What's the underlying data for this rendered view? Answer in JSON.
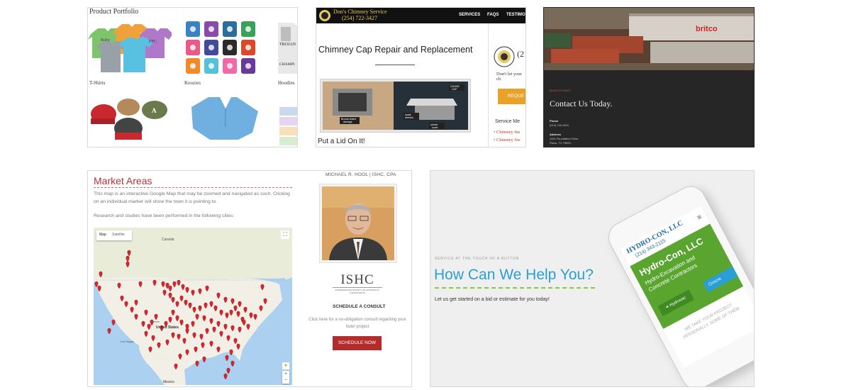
{
  "portfolio": {
    "title": "Product Portfolio",
    "captions": [
      "T-Shirts",
      "Koozies",
      "Hoodies"
    ]
  },
  "chimney": {
    "brand_name": "Don's Chimney Service",
    "brand_phone": "(254) 722-3427",
    "nav": [
      "SERVICES",
      "FAQS",
      "TESTIMO"
    ],
    "heading": "Chimney Cap Repair and Replacement",
    "subheading": "Put a Lid On It!",
    "side_phone": "(2",
    "side_tagline": "Don't let your ch",
    "side_button": "REQUE",
    "side_menu_title": "Service Me",
    "side_menu": [
      "Chimney Ins",
      "Chimney Sw"
    ],
    "photo_labels": [
      "Bronze-fluted damage",
      "spark arrestor",
      "GOOSE CAP",
      "screen cover"
    ]
  },
  "contact": {
    "roof_sign": "britco",
    "eyebrow": "QUESTIONS?",
    "heading": "Contact Us Today.",
    "phone_label": "Phone",
    "phone_value": "(214) 741-6311",
    "address_label": "Address",
    "address_line1": "1101 Foundation Drive",
    "address_line2": "Plano, TX 75093"
  },
  "market": {
    "title": "Market Areas",
    "para1": "This map is an interactive Google Map that may be zoomed and navigated as such. Clicking on an individual marker will show the town it is pointing to.",
    "para2": "Research and studies have been performed in the following cities:",
    "header": "MICHAEL R. HOOL | ISHC, CPA",
    "map_tabs": [
      "Map",
      "Satellite"
    ],
    "map_labels": [
      "Canada",
      "United States",
      "Mexico",
      "Las Vegas",
      "Denver"
    ],
    "logo": "ISHC",
    "logo_sub": "INTERNATIONAL SOCIETY OF HOSPITALITY CONSULTANTS",
    "schedule_heading": "SCHEDULE A CONSULT",
    "schedule_text": "Click here for a no-obligation consult regarding your hotel project",
    "schedule_button": "SCHEDULE NOW",
    "marker_color": "#d8262e"
  },
  "hydro": {
    "eyebrow": "SERVICE AT THE TOUCH OF A BUTTON",
    "heading": "How Can We Help You?",
    "text": "Let us get started on a bid or estimate for you today!",
    "phone_brand": "HYDRO-CON, LLC",
    "phone_number": "(214) 343-2115",
    "phone_hero_title": "Hydro-Con, LLC",
    "phone_hero_sub": "Hydro-Excavation and Concrete Contractors",
    "phone_btn1": "Hydrovac",
    "phone_btn2": "Concre",
    "phone_tagline": "WE TAKE YOUR PROJECT PERSONALLY. SOME OF THEM",
    "accent_blue": "#2a9fd6",
    "accent_green": "#5aa530"
  }
}
